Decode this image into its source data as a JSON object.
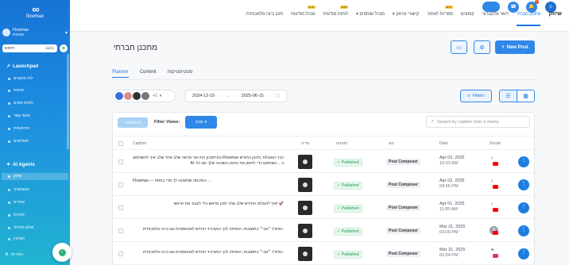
{
  "app": {
    "brand": "flowmax",
    "page_title": "מתכנן חברתי",
    "colors": {
      "primary": "#2f87e8",
      "published": "#1d9b53"
    }
  },
  "sidebar": {
    "org_name": "Flowmax",
    "org_sub": "סוכנות",
    "search_placeholder": "חיפוש",
    "search_kbd": "ctrl K",
    "launchpad_title": "Launchpad",
    "launchpad_items": [
      "לוח מחוונים",
      "שיחות",
      "לוחות זמנים",
      "אנשי קשר",
      "הזדמנויות",
      "תשלומים"
    ],
    "ai_title": "AI Agents",
    "ai_items": [
      "שיווק",
      "אוטומציה",
      "אתרים",
      "חברות",
      "אולם תהילה",
      "מוניטין"
    ],
    "footer": "הגדרות"
  },
  "topnav": {
    "brand_label": "שיווק",
    "items": [
      {
        "label": "מתכנן חברתי",
        "current": true,
        "badge": ""
      },
      {
        "label": "דואר אלקטרוני",
        "current": false,
        "badge": ""
      },
      {
        "label": "קופונים",
        "current": false,
        "badge": ""
      },
      {
        "label": "ספריות לאתור",
        "current": false,
        "badge": "חדש"
      },
      {
        "label": "קישורי טראק",
        "current": false,
        "badge": ""
      },
      {
        "label": "מנהל שותפים",
        "current": false,
        "badge": ""
      },
      {
        "label": "לוחות מודעות",
        "current": false,
        "badge": "חדש"
      },
      {
        "label": "מנהל מודעות",
        "current": false,
        "badge": "חדש"
      },
      {
        "label": "תוכן בינה מלאכותית",
        "current": false,
        "badge": ""
      }
    ],
    "notifications_count": "1"
  },
  "header": {
    "new_post_label": "New Post"
  },
  "tabs": [
    "Planner",
    "Content",
    "סטטיסטיקות"
  ],
  "toolbar": {
    "avatars_more": "+2",
    "date_from": "2024-12-15",
    "date_to": "2025-06-15",
    "filters_label": "Filters"
  },
  "filter_views": {
    "label": "Filter Views:",
    "select_a": "פעולות",
    "select_b": "מבט",
    "search_placeholder": "Search by caption (min 3 chars)"
  },
  "table": {
    "columns": [
      "Caption",
      "מדיה",
      "סטטוס",
      "סוג",
      "Date",
      "Social"
    ],
    "rows": [
      {
        "caption": "כבר הטעלות ,תכנון החודש Flowmax-בפייסבוק הזה אני מראה שלב אחר שלב איך להשתמש ב ...השתמש כדי לתזמן את התוכן השבועי שלך עם כלי AI",
        "rtl": true,
        "status": "Published",
        "composer": "Post Composer",
        "date": "Apr 03, 2025",
        "time": "10:33 AM",
        "social": "yt"
      },
      {
        "caption": "Flowmax — המיכסה שתזמנה לך מדי בפסח ...",
        "rtl": false,
        "status": "Published",
        "composer": "Post Composer",
        "date": "Apr 02, 2025",
        "time": "04:55 PM",
        "social": "yt"
      },
      {
        "caption": "🚀 !איך להעלות החודש שלב אחר תוכן מראש בלי לעבור את הראש",
        "rtl": true,
        "status": "Published",
        "composer": "Post Composer",
        "date": "Apr 01, 2025",
        "time": "11:55 AM",
        "social": "yt"
      },
      {
        "caption": ".הפיצ'ר ״אבי״ בתשובות, הוסיפה לכך המורביד החדש לאוטומציות עם בינה מלאכותית",
        "rtl": true,
        "status": "Published",
        "composer": "Post Composer",
        "date": "Mar 31, 2025",
        "time": "03:00 PM",
        "social": "av"
      },
      {
        "caption": ".הפיצ'ר ״אבי״ בתשובות, הוסיפה לכך המורביד החדש לאוטומציות עם בינה מלאכותית",
        "rtl": true,
        "status": "Published",
        "composer": "Post Composer",
        "date": "Mar 31, 2025",
        "time": "02:54 PM",
        "social": "x"
      }
    ]
  }
}
